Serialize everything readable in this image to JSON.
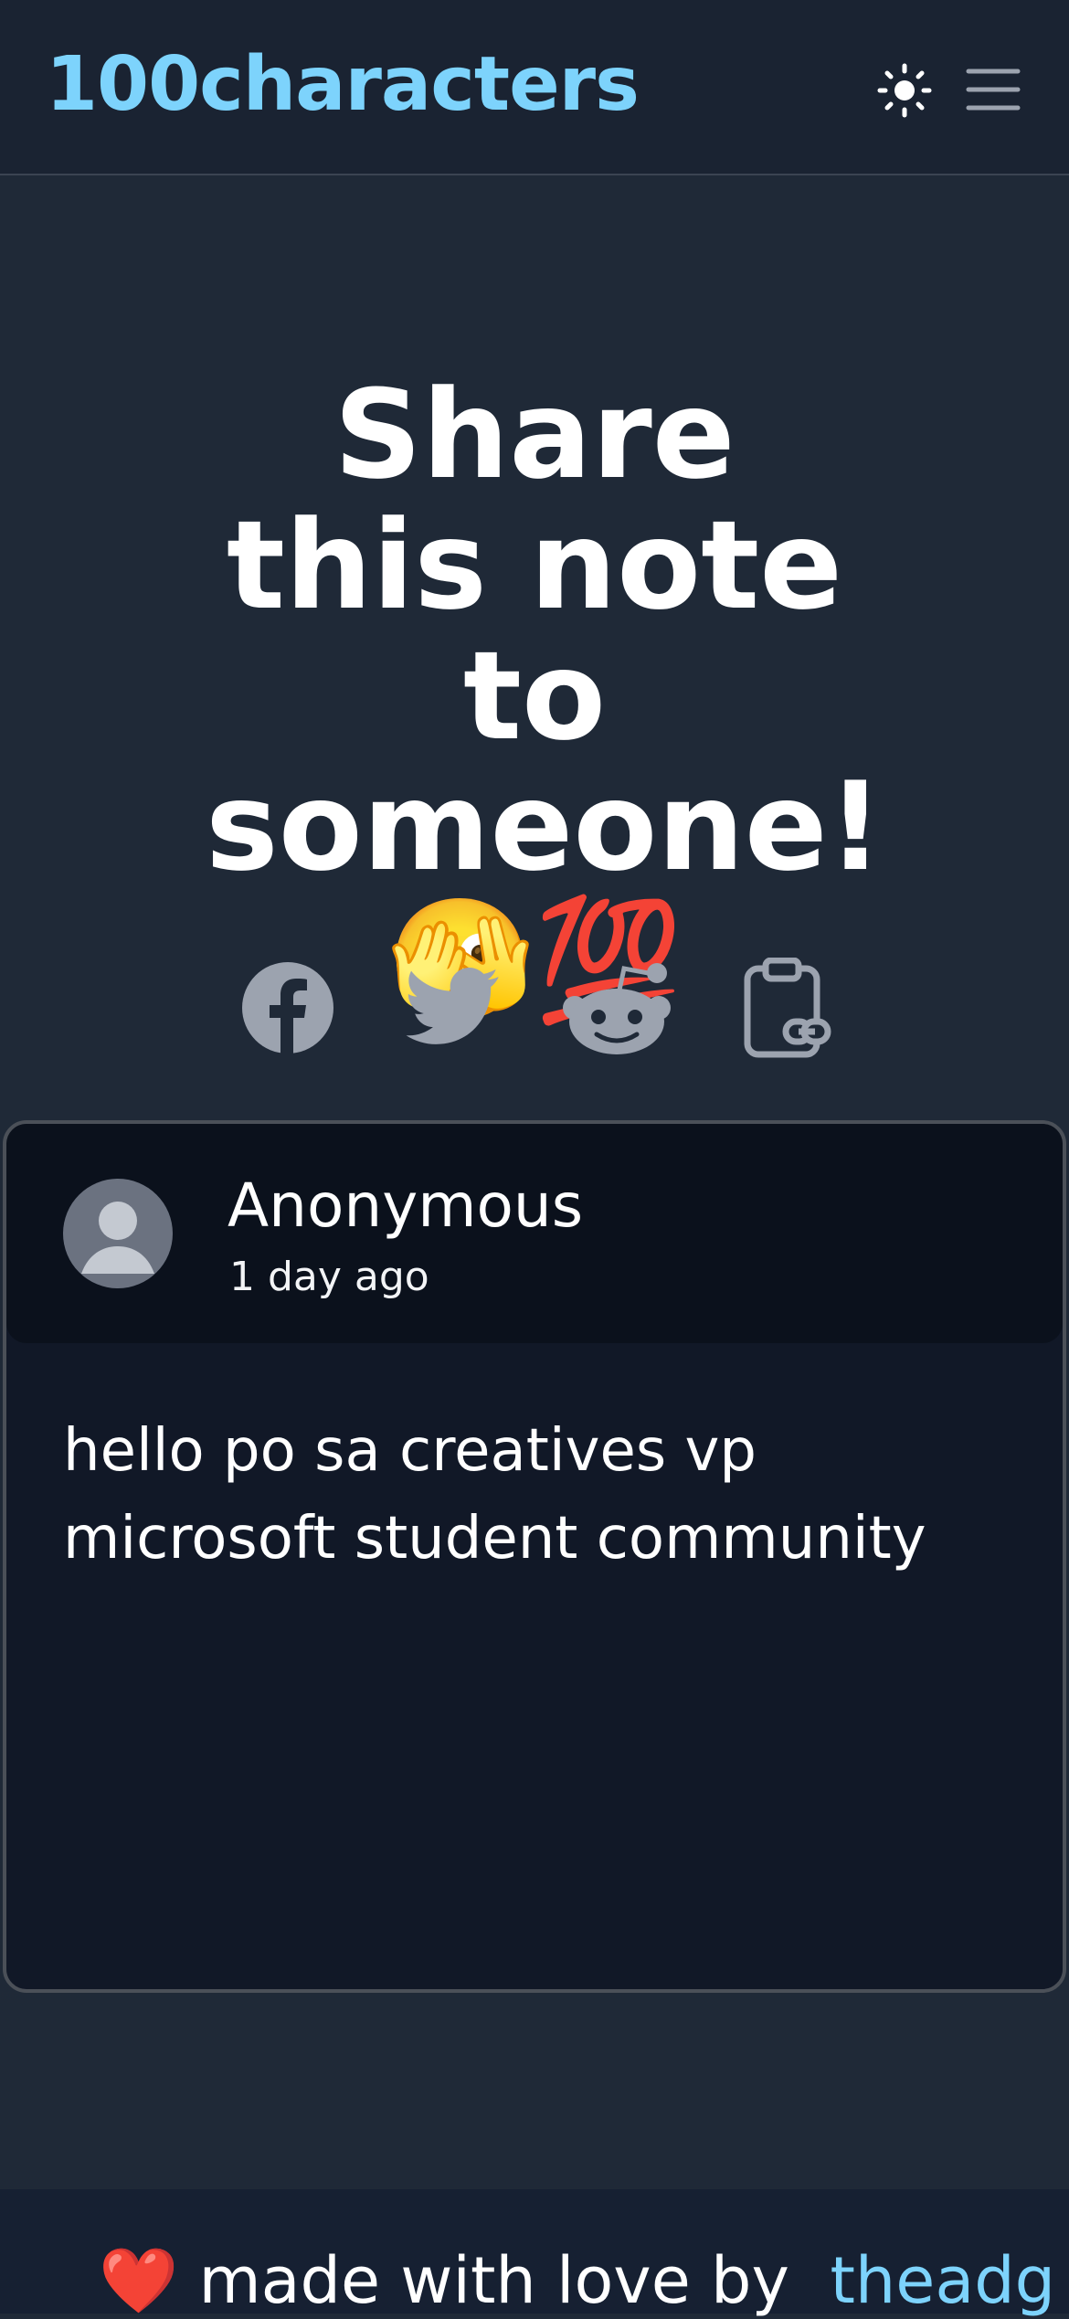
{
  "header": {
    "brand": "100characters",
    "theme_icon": "sun-icon",
    "menu_icon": "hamburger-menu-icon"
  },
  "hero": {
    "title": "Share this note to someone!",
    "emoji": "🫣💯"
  },
  "share": {
    "items": [
      {
        "name": "facebook",
        "icon": "facebook-icon"
      },
      {
        "name": "twitter",
        "icon": "twitter-icon"
      },
      {
        "name": "reddit",
        "icon": "reddit-icon"
      },
      {
        "name": "copy-link",
        "icon": "clipboard-link-icon"
      }
    ]
  },
  "note": {
    "author": "Anonymous",
    "time": "1 day ago",
    "text": "hello po sa creatives vp microsoft student community"
  },
  "footer": {
    "heart": "❤️",
    "text": "made with love by",
    "link": "theadg"
  },
  "colors": {
    "background": "#1f2937",
    "accent": "#7dd3fc",
    "card": "#111827",
    "icon": "#9ca3af"
  }
}
